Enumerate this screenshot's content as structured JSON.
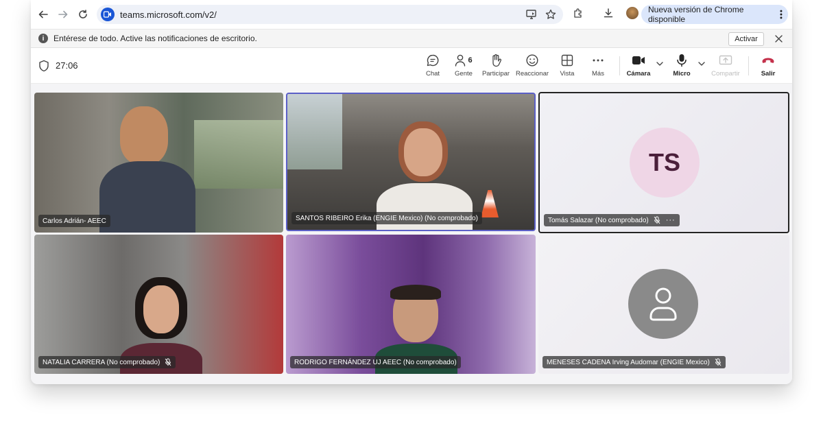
{
  "browser": {
    "url": "teams.microsoft.com/v2/",
    "update_label": "Nueva versión de Chrome disponible"
  },
  "notification": {
    "text": "Entérese de todo. Active las notificaciones de escritorio.",
    "action_label": "Activar"
  },
  "meeting": {
    "timer": "27:06",
    "controls": {
      "chat": "Chat",
      "people": "Gente",
      "people_count": "6",
      "raise": "Participar",
      "react": "Reaccionar",
      "view": "Vista",
      "more": "Más",
      "camera": "Cámara",
      "mic": "Micro",
      "share": "Compartir",
      "leave": "Salir"
    },
    "colors": {
      "accent": "#5b5fc7",
      "leave": "#c4314b",
      "active_border": "#242424"
    }
  },
  "participants": [
    {
      "name": "Carlos Adrián- AEEC",
      "muted": false,
      "video": true
    },
    {
      "name": "SANTOS RIBEIRO Erika (ENGIE Mexico) (No comprobado)",
      "muted": false,
      "video": true,
      "speaking": true
    },
    {
      "name": "Tomás Salazar (No comprobado)",
      "muted": true,
      "video": false,
      "initials": "TS"
    },
    {
      "name": "NATALIA CARRERA (No comprobado)",
      "muted": true,
      "video": true
    },
    {
      "name": "RODRIGO FERNÁNDEZ UJ AEEC (No comprobado)",
      "muted": false,
      "video": true
    },
    {
      "name": "MENESES CADENA Irving Audomar (ENGIE Mexico)",
      "muted": true,
      "video": false
    }
  ]
}
